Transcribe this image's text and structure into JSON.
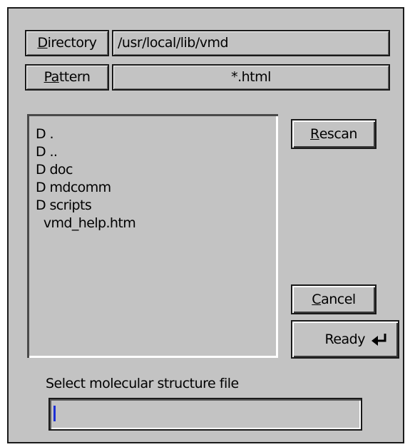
{
  "directory": {
    "label_prefix": "D",
    "label_rest": "irectory",
    "value": "/usr/local/lib/vmd"
  },
  "pattern": {
    "label_prefix": "Pa",
    "label_rest": "ttern",
    "value": "*.html"
  },
  "file_list": {
    "items": [
      "D .",
      "D ..",
      "D doc",
      "D mdcomm",
      "D scripts",
      "  vmd_help.htm"
    ]
  },
  "buttons": {
    "rescan": {
      "accel": "R",
      "rest": "escan"
    },
    "cancel": {
      "accel": "C",
      "rest": "ancel"
    },
    "ready": {
      "label": "Ready",
      "icon": "return-arrow-icon"
    }
  },
  "prompt": {
    "text": "Select molecular structure file"
  },
  "filename_input": {
    "value": ""
  },
  "colors": {
    "background": "#c3c3c3",
    "caret": "#1c2fd6"
  }
}
